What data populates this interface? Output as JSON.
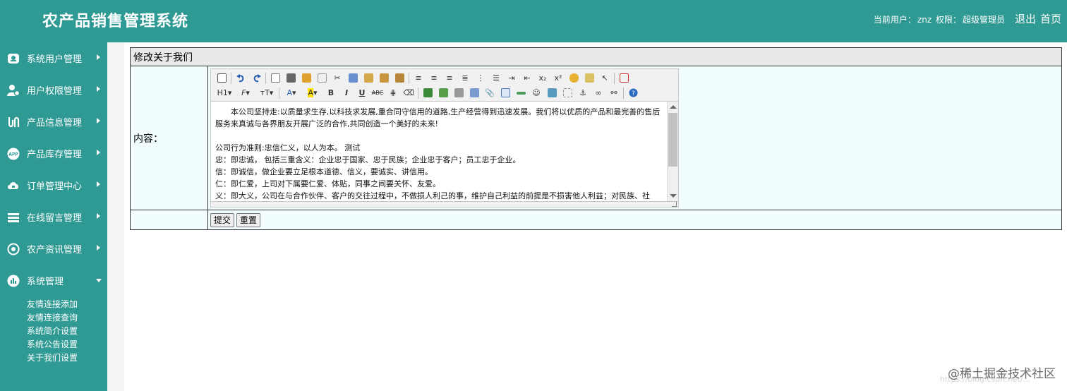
{
  "header": {
    "app_title": "农产品销售管理系统",
    "current_user_label": "当前用户：",
    "current_user": "znz",
    "permission_label": "权限：",
    "permission": "超级管理员",
    "logout": "退出",
    "home": "首页"
  },
  "sidebar": {
    "items": [
      {
        "label": "系统用户管理",
        "icon": "user-badge-icon"
      },
      {
        "label": "用户权限管理",
        "icon": "user-gear-icon"
      },
      {
        "label": "产品信息管理",
        "icon": "product-icon"
      },
      {
        "label": "产品库存管理",
        "icon": "app-icon"
      },
      {
        "label": "订单管理中心",
        "icon": "cloud-icon"
      },
      {
        "label": "在线留言管理",
        "icon": "layers-icon"
      },
      {
        "label": "农产资讯管理",
        "icon": "settings-icon"
      },
      {
        "label": "系统管理",
        "icon": "bar-chart-icon"
      }
    ],
    "submenu": [
      "友情连接添加",
      "友情连接查询",
      "系统简介设置",
      "系统公告设置",
      "关于我们设置"
    ]
  },
  "form": {
    "title": "修改关于我们",
    "content_label": "内容：",
    "submit_label": "提交",
    "reset_label": "重置"
  },
  "editor": {
    "heading_label": "H1",
    "paragraphs": [
      "　　本公司坚持走:以质量求生存,以科技求发展,重合同守信用的道路,生产经营得到迅速发展。我们将以优质的产品和最完善的售后服务来真诚与各界朋友开展广泛的合作,共同创造一个美好的未来!",
      "",
      "公司行为准则:忠信仁义，以人为本。 测试",
      "忠：即忠诚， 包括三重含义：企业忠于国家、忠于民族；企业忠于客户；员工忠于企业。",
      "信：即诚信，做企业要立足根本道德、信义，要诚实、讲信用。",
      "仁：即仁爱，上司对下属要仁爱、体贴，同事之间要关怀、友爱。",
      "义：即大义，公司在与合作伙伴、客户的交往过程中，不做损人利己的事，维护自己利益的前提是不损害他人利益；对民族、社"
    ]
  },
  "watermark": {
    "text": "@稀土掘金技术社区",
    "sub": "https://blog.csdn.net/..."
  },
  "colors": {
    "brand": "#2f9a94",
    "panel": "#f2fdff"
  }
}
